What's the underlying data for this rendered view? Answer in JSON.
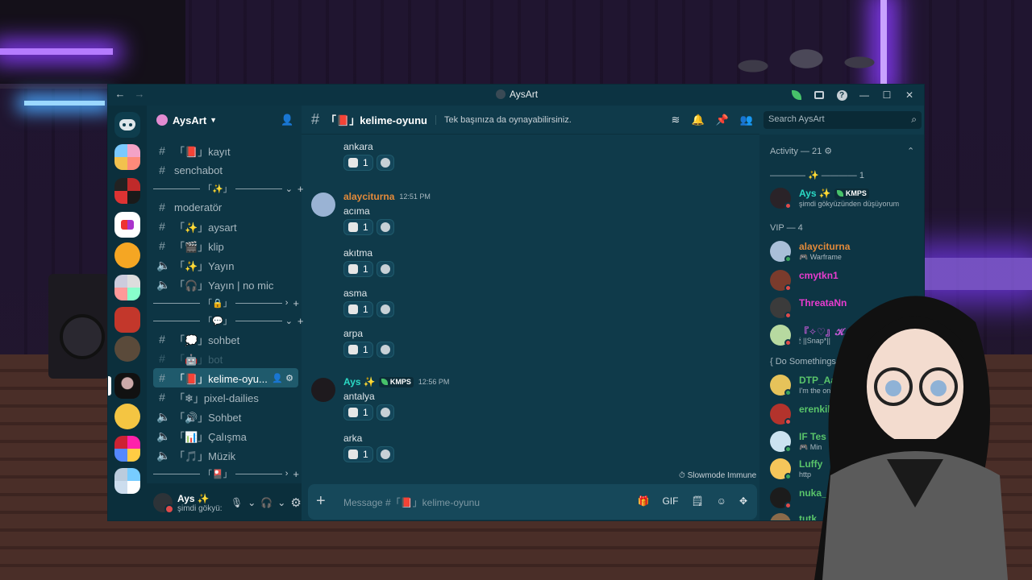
{
  "window": {
    "title": "AysArt",
    "nav_back": "←",
    "nav_forward": "→"
  },
  "server": {
    "name": "AysArt",
    "search_placeholder": "Search AysArt"
  },
  "channels": [
    {
      "type": "text",
      "label": "「📕」kayıt"
    },
    {
      "type": "text",
      "label": "senchabot"
    },
    {
      "type": "category",
      "label": "「✨」",
      "control": "⌄"
    },
    {
      "type": "text",
      "label": "moderatör"
    },
    {
      "type": "text",
      "label": "「✨」aysart"
    },
    {
      "type": "text",
      "label": "「🎬」klip"
    },
    {
      "type": "voice",
      "label": "「✨」Yayın"
    },
    {
      "type": "voice",
      "label": "「🎧」Yayın | no mic"
    },
    {
      "type": "category",
      "label": "「🔒」",
      "control": "›"
    },
    {
      "type": "category",
      "label": "「💬」",
      "control": "⌄"
    },
    {
      "type": "text",
      "label": "「💭」sohbet"
    },
    {
      "type": "text-muted",
      "label": "「🤖」bot"
    },
    {
      "type": "text-active",
      "label": "「📕」kelime-oyu..."
    },
    {
      "type": "text",
      "label": "「❄」pixel-dailies"
    },
    {
      "type": "voice",
      "label": "「🔊」Sohbet"
    },
    {
      "type": "voice",
      "label": "「📊」Çalışma"
    },
    {
      "type": "voice",
      "label": "「🎵」Müzik"
    },
    {
      "type": "category",
      "label": "「🎴」",
      "control": "›"
    }
  ],
  "chat": {
    "channel_name": "「📕」kelime-oyunu",
    "topic": "Tek başınıza da oynayabilirsiniz.",
    "composer_placeholder": "Message #「📕」kelime-oyunu",
    "slowmode": "Slowmode Immune",
    "reaction_count": "1",
    "messages": [
      {
        "author": "",
        "time": "",
        "text": "ankara"
      },
      {
        "author": "alayciturna",
        "time": "12:51 PM",
        "text": "acıma"
      },
      {
        "author": "",
        "time": "",
        "text": "akıtma"
      },
      {
        "author": "",
        "time": "",
        "text": "asma"
      },
      {
        "author": "",
        "time": "",
        "text": "arpa"
      },
      {
        "author": "Ays ✨",
        "time": "12:56 PM",
        "text": "antalya",
        "tag": "KMPS"
      },
      {
        "author": "",
        "time": "",
        "text": "arka"
      }
    ]
  },
  "user_panel": {
    "name": "Ays ✨",
    "status": "şimdi gökyü:"
  },
  "members": {
    "sections": [
      {
        "label": "Activity — 21 ⚙"
      },
      {
        "label": "———— ✨ ———— 1"
      },
      {
        "label": "VIP — 4"
      },
      {
        "label": "{ Do Somethings } — 6"
      }
    ],
    "list": [
      {
        "name": "Ays ✨",
        "sub": "şimdi gökyüzünden düşüyorum",
        "color": "#2bd9c4",
        "tag": "KMPS",
        "status": "dnd"
      },
      {
        "name": "alayciturna",
        "sub": "🎮 Warframe",
        "color": "#e38a3a",
        "status": "online"
      },
      {
        "name": "cmytkn1",
        "sub": "",
        "color": "#e83ccf",
        "status": "dnd"
      },
      {
        "name": "ThreataNn",
        "sub": "",
        "color": "#e83ccf",
        "status": "dnd"
      },
      {
        "name": "『✧♡』𝓚...",
        "sub": "🕯 ||Snap*||",
        "color": "#c45ad6",
        "status": "dnd"
      },
      {
        "name": "DTP_Aaron",
        "sub": "I'm the only one w",
        "color": "#59c46a",
        "status": "online"
      },
      {
        "name": "erenkilic",
        "sub": "",
        "color": "#59c46a",
        "status": "dnd"
      },
      {
        "name": "IF Tes",
        "sub": "🎮 Min",
        "color": "#59c46a",
        "status": "online"
      },
      {
        "name": "Luffy",
        "sub": "http",
        "color": "#59c46a",
        "status": "online"
      },
      {
        "name": "nuka_",
        "sub": "",
        "color": "#59c46a",
        "status": "dnd"
      },
      {
        "name": "tutk",
        "sub": "",
        "color": "#59c46a",
        "status": "dnd"
      }
    ]
  },
  "colors": {
    "bg_main": "#0f3a4a",
    "sidebar": "#0d3544",
    "accent_orange": "#e38a3a",
    "accent_teal": "#2bd9c4",
    "online": "#3ba55d",
    "dnd": "#e14b4b"
  }
}
